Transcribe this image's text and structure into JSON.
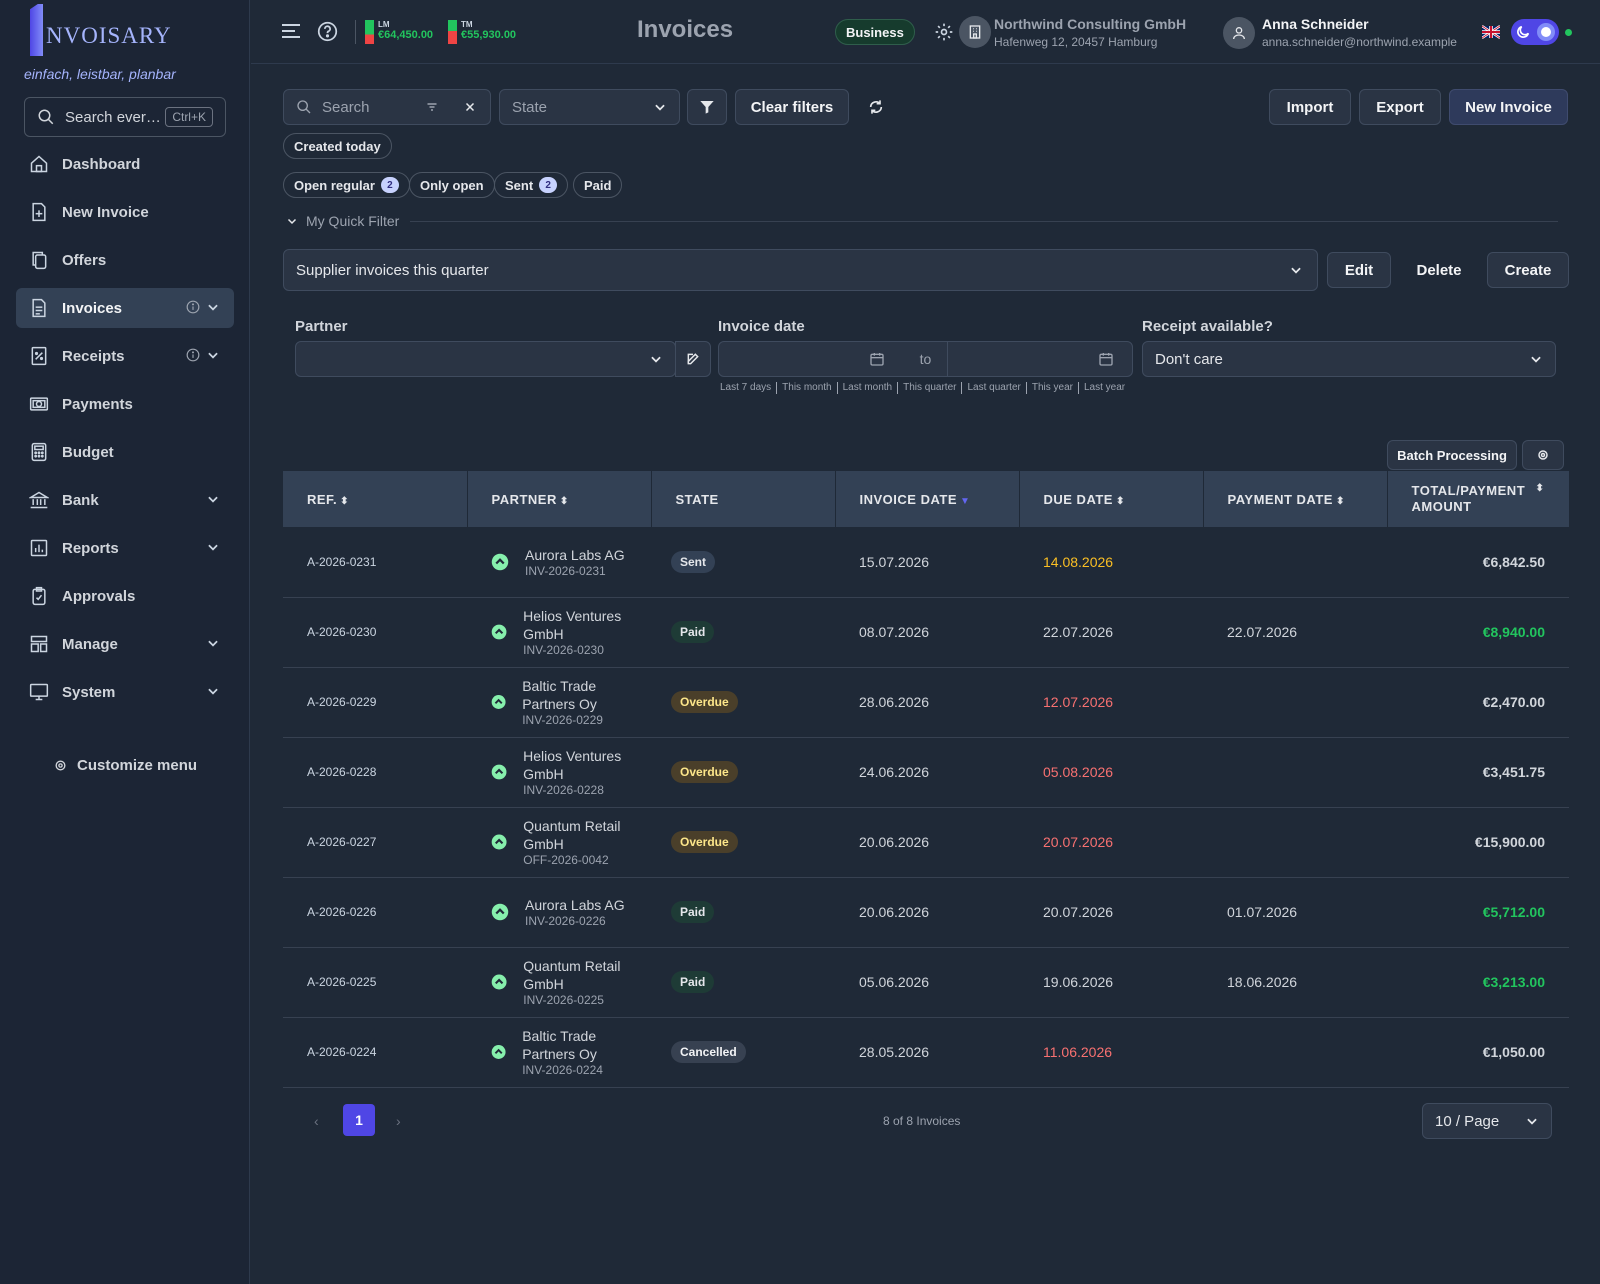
{
  "brand": {
    "logo_text": "NVOISARY",
    "tagline": "einfach, leistbar, planbar"
  },
  "sidebar": {
    "search_placeholder": "Search ever…",
    "search_shortcut": "Ctrl+K",
    "items": [
      {
        "label": "Dashboard",
        "icon": "home-icon"
      },
      {
        "label": "New Invoice",
        "icon": "file-plus-icon"
      },
      {
        "label": "Offers",
        "icon": "copy-icon"
      },
      {
        "label": "Invoices",
        "icon": "document-icon",
        "active": true,
        "info": true,
        "chevron": true
      },
      {
        "label": "Receipts",
        "icon": "receipt-icon",
        "info": true,
        "chevron": true
      },
      {
        "label": "Payments",
        "icon": "cash-icon"
      },
      {
        "label": "Budget",
        "icon": "calculator-icon"
      },
      {
        "label": "Bank",
        "icon": "bank-icon",
        "chevron": true
      },
      {
        "label": "Reports",
        "icon": "chart-icon",
        "chevron": true
      },
      {
        "label": "Approvals",
        "icon": "clipboard-check-icon"
      },
      {
        "label": "Manage",
        "icon": "layout-icon",
        "chevron": true
      },
      {
        "label": "System",
        "icon": "monitor-icon",
        "chevron": true
      }
    ],
    "customize_label": "Customize menu"
  },
  "topbar": {
    "lm_label": "LM",
    "lm_value": "€64,450.00",
    "tm_label": "TM",
    "tm_value": "€55,930.00",
    "title": "Invoices",
    "plan_badge": "Business",
    "company_name": "Northwind Consulting GmbH",
    "company_address": "Hafenweg 12, 20457 Hamburg",
    "user_name": "Anna Schneider",
    "user_email": "anna.schneider@northwind.example"
  },
  "filters": {
    "search_placeholder": "Search",
    "state_placeholder": "State",
    "clear_filters": "Clear filters",
    "import": "Import",
    "export": "Export",
    "new_invoice": "New Invoice",
    "chips": [
      {
        "label": "Created today"
      },
      {
        "label": "Open regular",
        "count": "2"
      },
      {
        "label": "Only open"
      },
      {
        "label": "Sent",
        "count": "2"
      },
      {
        "label": "Paid"
      }
    ],
    "quick_filter_label": "My Quick Filter",
    "quick_filter_value": "Supplier invoices this quarter",
    "edit": "Edit",
    "delete": "Delete",
    "create": "Create",
    "partner_label": "Partner",
    "invoice_date_label": "Invoice date",
    "date_to": "to",
    "receipt_label": "Receipt available?",
    "receipt_value": "Don't care",
    "date_shortcuts": [
      "Last 7 days",
      "This month",
      "Last month",
      "This quarter",
      "Last quarter",
      "This year",
      "Last year"
    ]
  },
  "table": {
    "batch_processing": "Batch Processing",
    "columns": [
      "REF.",
      "PARTNER",
      "STATE",
      "INVOICE DATE",
      "DUE DATE",
      "PAYMENT DATE",
      "TOTAL/PAYMENT AMOUNT"
    ],
    "rows": [
      {
        "ref": "A-2026-0231",
        "partner": "Aurora Labs AG",
        "number": "INV-2026-0231",
        "state": "Sent",
        "invoice_date": "15.07.2026",
        "due_date": "14.08.2026",
        "due_color": "amber",
        "payment_date": "",
        "amount": "€6,842.50",
        "amount_color": ""
      },
      {
        "ref": "A-2026-0230",
        "partner": "Helios Ventures GmbH",
        "number": "INV-2026-0230",
        "state": "Paid",
        "invoice_date": "08.07.2026",
        "due_date": "22.07.2026",
        "due_color": "",
        "payment_date": "22.07.2026",
        "amount": "€8,940.00",
        "amount_color": "green"
      },
      {
        "ref": "A-2026-0229",
        "partner": "Baltic Trade Partners Oy",
        "number": "INV-2026-0229",
        "state": "Overdue",
        "invoice_date": "28.06.2026",
        "due_date": "12.07.2026",
        "due_color": "red",
        "payment_date": "",
        "amount": "€2,470.00",
        "amount_color": ""
      },
      {
        "ref": "A-2026-0228",
        "partner": "Helios Ventures GmbH",
        "number": "INV-2026-0228",
        "state": "Overdue",
        "invoice_date": "24.06.2026",
        "due_date": "05.08.2026",
        "due_color": "red",
        "payment_date": "",
        "amount": "€3,451.75",
        "amount_color": ""
      },
      {
        "ref": "A-2026-0227",
        "partner": "Quantum Retail GmbH",
        "number": "OFF-2026-0042",
        "state": "Overdue",
        "invoice_date": "20.06.2026",
        "due_date": "20.07.2026",
        "due_color": "red",
        "payment_date": "",
        "amount": "€15,900.00",
        "amount_color": ""
      },
      {
        "ref": "A-2026-0226",
        "partner": "Aurora Labs AG",
        "number": "INV-2026-0226",
        "state": "Paid",
        "invoice_date": "20.06.2026",
        "due_date": "20.07.2026",
        "due_color": "",
        "payment_date": "01.07.2026",
        "amount": "€5,712.00",
        "amount_color": "green"
      },
      {
        "ref": "A-2026-0225",
        "partner": "Quantum Retail GmbH",
        "number": "INV-2026-0225",
        "state": "Paid",
        "invoice_date": "05.06.2026",
        "due_date": "19.06.2026",
        "due_color": "",
        "payment_date": "18.06.2026",
        "amount": "€3,213.00",
        "amount_color": "green"
      },
      {
        "ref": "A-2026-0224",
        "partner": "Baltic Trade Partners Oy",
        "number": "INV-2026-0224",
        "state": "Cancelled",
        "invoice_date": "28.05.2026",
        "due_date": "11.06.2026",
        "due_color": "red",
        "payment_date": "",
        "amount": "€1,050.00",
        "amount_color": ""
      }
    ]
  },
  "pagination": {
    "current_page": "1",
    "summary": "8 of 8 Invoices",
    "page_size": "10 / Page"
  },
  "colors": {
    "accent": "#4f46e5",
    "green": "#22c55e",
    "red": "#f87171",
    "amber": "#fbbf24"
  }
}
